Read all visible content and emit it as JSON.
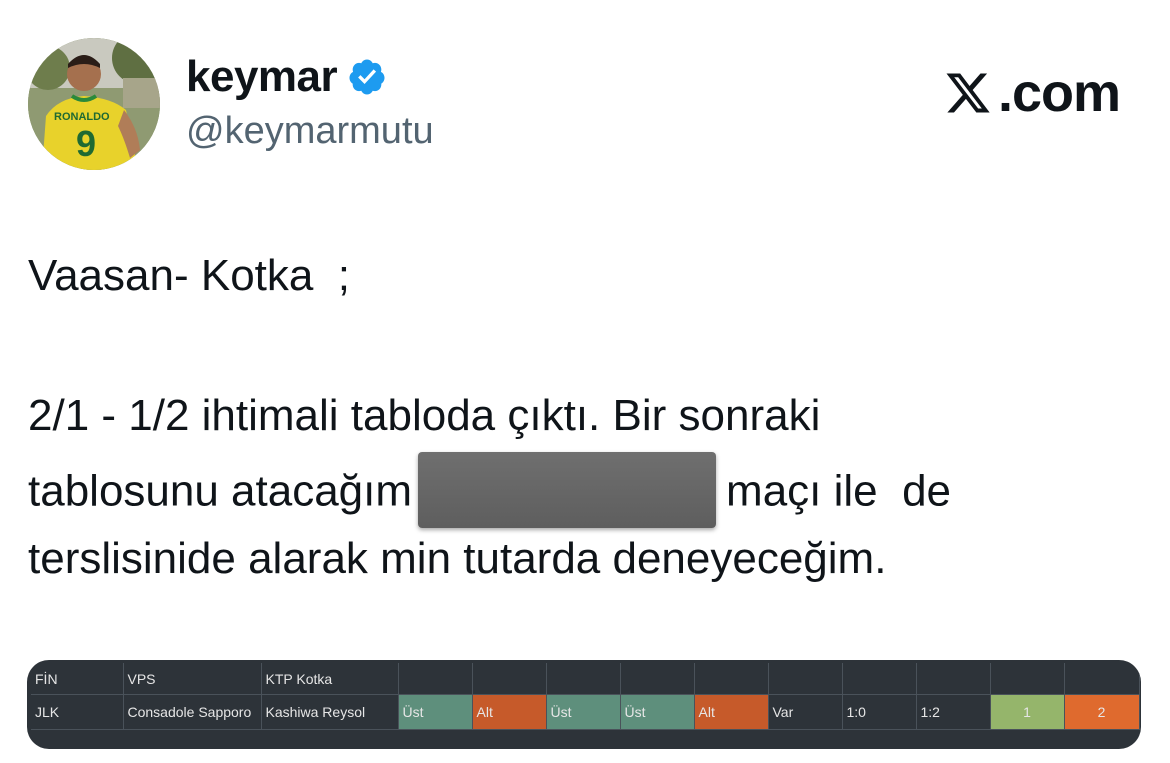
{
  "profile": {
    "name": "keymar",
    "handle": "@keymarmutu",
    "avatar_shirt_text": "RONALDO",
    "avatar_shirt_number": "9"
  },
  "brand": {
    "site": ".com"
  },
  "tweet": {
    "line1": "Vaasan- Kotka  ;",
    "line2": "2/1 - 1/2 ihtimali tabloda çıktı. Bir sonraki",
    "line3a": "tablosunu atacağım",
    "line3b": "maçı ile  de",
    "line4": "terslisinide alarak min tutarda deneyeceğim."
  },
  "table": {
    "row1": [
      "FİN",
      "VPS",
      "KTP Kotka",
      "",
      "",
      "",
      "",
      "",
      "",
      "",
      "",
      "",
      ""
    ],
    "row2": [
      "JLK",
      "Consadole Sapporo",
      "Kashiwa Reysol",
      "Üst",
      "Alt",
      "Üst",
      "Üst",
      "Alt",
      "Var",
      "1:0",
      "1:2",
      "1",
      "2"
    ]
  },
  "colors": {
    "verified": "#1d9bf0",
    "ust_cell": "#5e8f7c",
    "alt_cell": "#c65a2a",
    "one_cell": "#95b56b",
    "two_cell": "#df6a2e"
  }
}
